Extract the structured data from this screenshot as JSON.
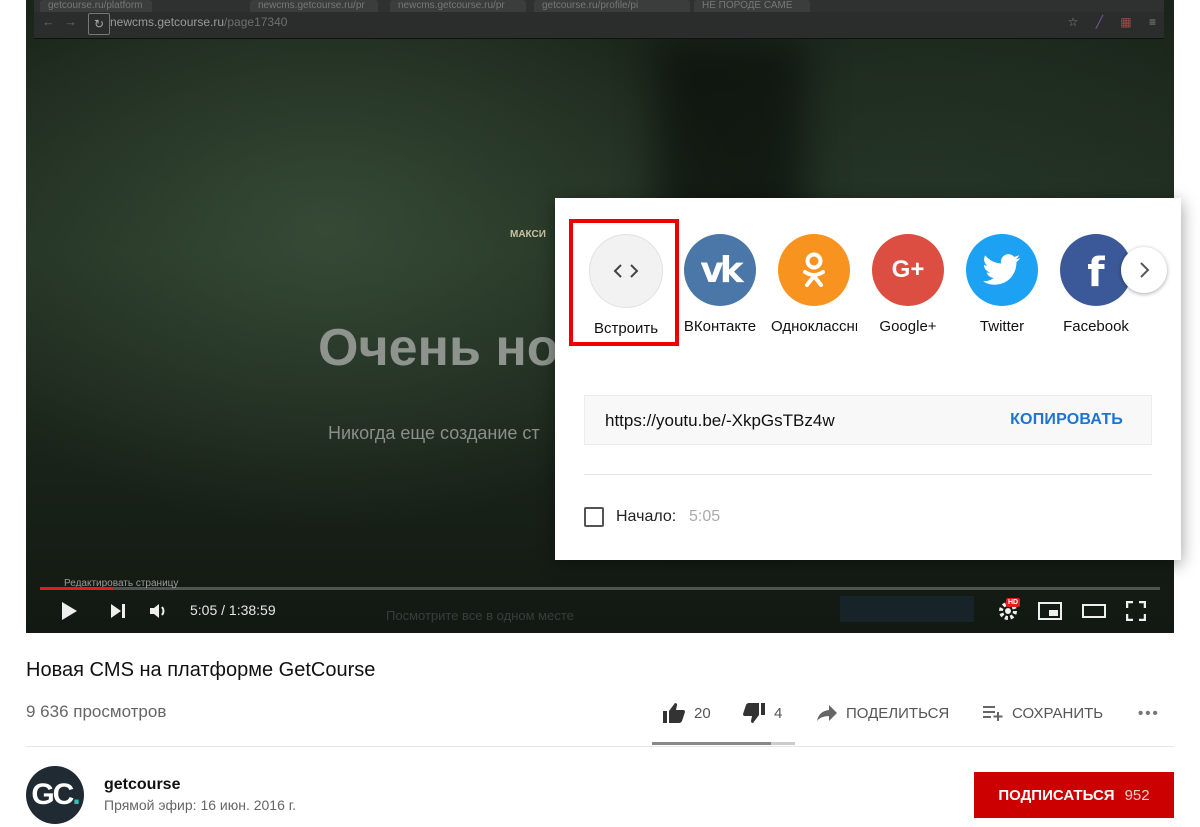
{
  "inner_browser": {
    "tabs": [
      "getcourse.ru/platform",
      "newcms.getcourse.ru/pr",
      "newcms.getcourse.ru/pr",
      "getcourse.ru/profile/pi",
      "НЕ ПОРОДЕ САМЕ"
    ],
    "url_host": "newcms.getcourse.ru",
    "url_path": "/page17340",
    "reload_glyph": "↻"
  },
  "video": {
    "logo_text": "МАКСИ",
    "headline": "Очень но",
    "subtitle": "Никогда еще создание ст",
    "edit_page": "Редактировать страницу",
    "ghost_text": "Посмотрите все в одном месте",
    "progress": 0.065,
    "time": "5:05 / 1:38:59",
    "hd_badge": "HD"
  },
  "share": {
    "targets": [
      {
        "label": "Встроить",
        "icon": "embed-code-icon",
        "color": "#f2f2f2"
      },
      {
        "label": "ВКонтакте",
        "icon": "vk-icon",
        "color": "#4a76a8"
      },
      {
        "label": "Одноклассники",
        "icon": "odnoklassniki-icon",
        "color": "#f7931e"
      },
      {
        "label": "Google+",
        "icon": "google-plus-icon",
        "color": "#dc4e41"
      },
      {
        "label": "Twitter",
        "icon": "twitter-icon",
        "color": "#1da1f2"
      },
      {
        "label": "Facebook",
        "icon": "facebook-icon",
        "color": "#3b5998"
      }
    ],
    "link": "https://youtu.be/-XkpGsTBz4w",
    "copy_label": "КОПИРОВАТЬ",
    "start_label": "Начало:",
    "start_value": "5:05",
    "start_checked": false
  },
  "info": {
    "title": "Новая CMS на платформе GetCourse",
    "views": "9 636 просмотров",
    "likes": "20",
    "dislikes": "4",
    "like_ratio": 0.83,
    "share_label": "ПОДЕЛИТЬСЯ",
    "save_label": "СОХРАНИТЬ",
    "more_label": "•••"
  },
  "channel": {
    "avatar_text": "GC",
    "avatar_dot": ".",
    "name": "getcourse",
    "published": "Прямой эфир: 16 июн. 2016 г.",
    "subscribe_label": "ПОДПИСАТЬСЯ",
    "subscriber_count": "952"
  },
  "colors": {
    "accent_red": "#cc0000",
    "link_blue": "#1f74cf",
    "highlight_red": "#ee0000"
  }
}
